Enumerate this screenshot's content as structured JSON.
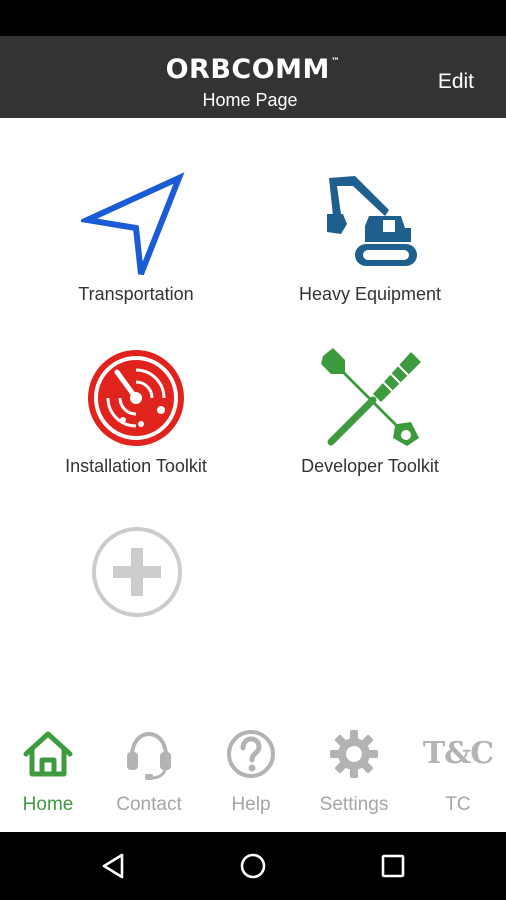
{
  "header": {
    "brand": "ORBCOMM",
    "brand_mark": "™",
    "title": "Home Page",
    "edit_label": "Edit"
  },
  "tiles": [
    {
      "label": "Transportation",
      "icon": "navigation-arrow-icon",
      "color": "#1c5bd6"
    },
    {
      "label": "Heavy Equipment",
      "icon": "excavator-icon",
      "color": "#1f5f8e"
    },
    {
      "label": "Installation Toolkit",
      "icon": "radar-icon",
      "color": "#e0231c"
    },
    {
      "label": "Developer Toolkit",
      "icon": "wrench-screwdriver-icon",
      "color": "#3e9a3f"
    }
  ],
  "add_tile": {
    "icon": "add-circle-icon",
    "color": "#cccccc"
  },
  "bottom_nav": {
    "items": [
      {
        "label": "Home",
        "icon": "home-icon",
        "active": true
      },
      {
        "label": "Contact",
        "icon": "headset-icon",
        "active": false
      },
      {
        "label": "Help",
        "icon": "help-circle-icon",
        "active": false
      },
      {
        "label": "Settings",
        "icon": "gear-icon",
        "active": false
      },
      {
        "label": "TC",
        "icon": "terms-conditions-icon",
        "glyph": "T&C",
        "active": false
      }
    ],
    "active_color": "#3e9a3f",
    "inactive_color": "#a6a6a6"
  },
  "system_nav": {
    "buttons": [
      "back-icon",
      "home-circle-icon",
      "recents-icon"
    ]
  }
}
